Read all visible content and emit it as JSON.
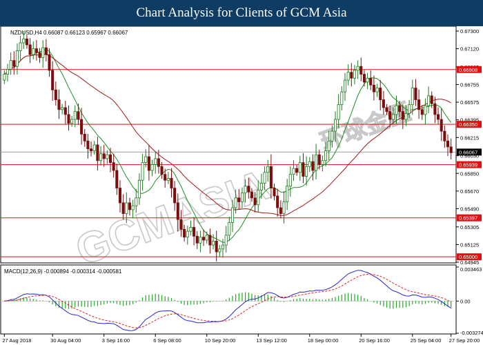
{
  "banner": {
    "title": "Chart Analysis for Clients of GCM Asia"
  },
  "watermark": {
    "text": "GCMASIA",
    "cjk": "环球金匯"
  },
  "colors": {
    "bull": "#1a7a1a",
    "bear": "#7a0e0e",
    "fast_ma": "#1f8f1f",
    "slow_ma": "#a01818",
    "level_line": "#e01010",
    "level_bg": "#e01010",
    "current_bg": "#000000",
    "macd_line": "#2525d0",
    "signal_line": "#e02020",
    "hist": "#22a822"
  },
  "chart_data": [
    {
      "type": "candlestick",
      "title": "NZDUSD,H4  0.66087 0.66123 0.65967 0.66067",
      "current_price": "0.66067",
      "y_ticks": [
        "0.67300",
        "0.67120",
        "0.66935",
        "0.66755",
        "0.66575",
        "0.66395",
        "0.66215",
        "0.66030",
        "0.65850",
        "0.65670",
        "0.65490",
        "0.65305",
        "0.65125",
        "0.64945"
      ],
      "ylim": [
        0.64945,
        0.673
      ],
      "x_ticks": [
        "27 Aug 2018",
        "30 Aug 04:00",
        "3 Sep 16:00",
        "6 Sep 08:00",
        "10 Sep 20:00",
        "13 Sep 12:00",
        "18 Sep 00:00",
        "20 Sep 16:00",
        "25 Sep 04:00",
        "27 Sep 20:00"
      ],
      "levels": [
        "0.66908",
        "0.66350",
        "0.65939",
        "0.65397",
        "0.65000"
      ],
      "close": [
        0.6686,
        0.6691,
        0.67,
        0.6694,
        0.671,
        0.6718,
        0.6722,
        0.6716,
        0.6706,
        0.6712,
        0.6708,
        0.6703,
        0.6713,
        0.6706,
        0.669,
        0.667,
        0.666,
        0.665,
        0.6652,
        0.6645,
        0.6636,
        0.664,
        0.6648,
        0.664,
        0.6625,
        0.6618,
        0.661,
        0.6608,
        0.6614,
        0.6598,
        0.6605,
        0.66,
        0.6604,
        0.6596,
        0.6588,
        0.657,
        0.6555,
        0.6544,
        0.6555,
        0.6548,
        0.6552,
        0.656,
        0.6578,
        0.6596,
        0.6602,
        0.6588,
        0.6594,
        0.66,
        0.6592,
        0.6584,
        0.6578,
        0.658,
        0.657,
        0.6555,
        0.6538,
        0.6528,
        0.652,
        0.6526,
        0.653,
        0.6521,
        0.6514,
        0.652,
        0.6517,
        0.6522,
        0.6512,
        0.6516,
        0.6505,
        0.6508,
        0.6512,
        0.6522,
        0.6535,
        0.655,
        0.656,
        0.6556,
        0.6565,
        0.6572,
        0.6566,
        0.656,
        0.6553,
        0.6568,
        0.6575,
        0.6586,
        0.6592,
        0.657,
        0.6562,
        0.655,
        0.6544,
        0.6556,
        0.6572,
        0.6584,
        0.659,
        0.6586,
        0.6596,
        0.6582,
        0.6592,
        0.6597,
        0.6588,
        0.6604,
        0.6594,
        0.6598,
        0.6608,
        0.6618,
        0.6628,
        0.664,
        0.6655,
        0.6668,
        0.668,
        0.6688,
        0.6682,
        0.669,
        0.6694,
        0.6686,
        0.6678,
        0.6682,
        0.6675,
        0.6668,
        0.6672,
        0.666,
        0.6652,
        0.6648,
        0.664,
        0.6645,
        0.6654,
        0.6648,
        0.664,
        0.6646,
        0.6655,
        0.6672,
        0.666,
        0.665,
        0.6645,
        0.6654,
        0.6664,
        0.6656,
        0.6645,
        0.664,
        0.6628,
        0.6618,
        0.6612,
        0.6606
      ]
    },
    {
      "type": "line",
      "title": "MACD(12,26,9) -0.000894 -0.000314 -0.000581",
      "y_ticks": [
        "0.003463",
        "0.00",
        "-0.003274"
      ],
      "ylim": [
        -0.003274,
        0.003463
      ]
    }
  ]
}
